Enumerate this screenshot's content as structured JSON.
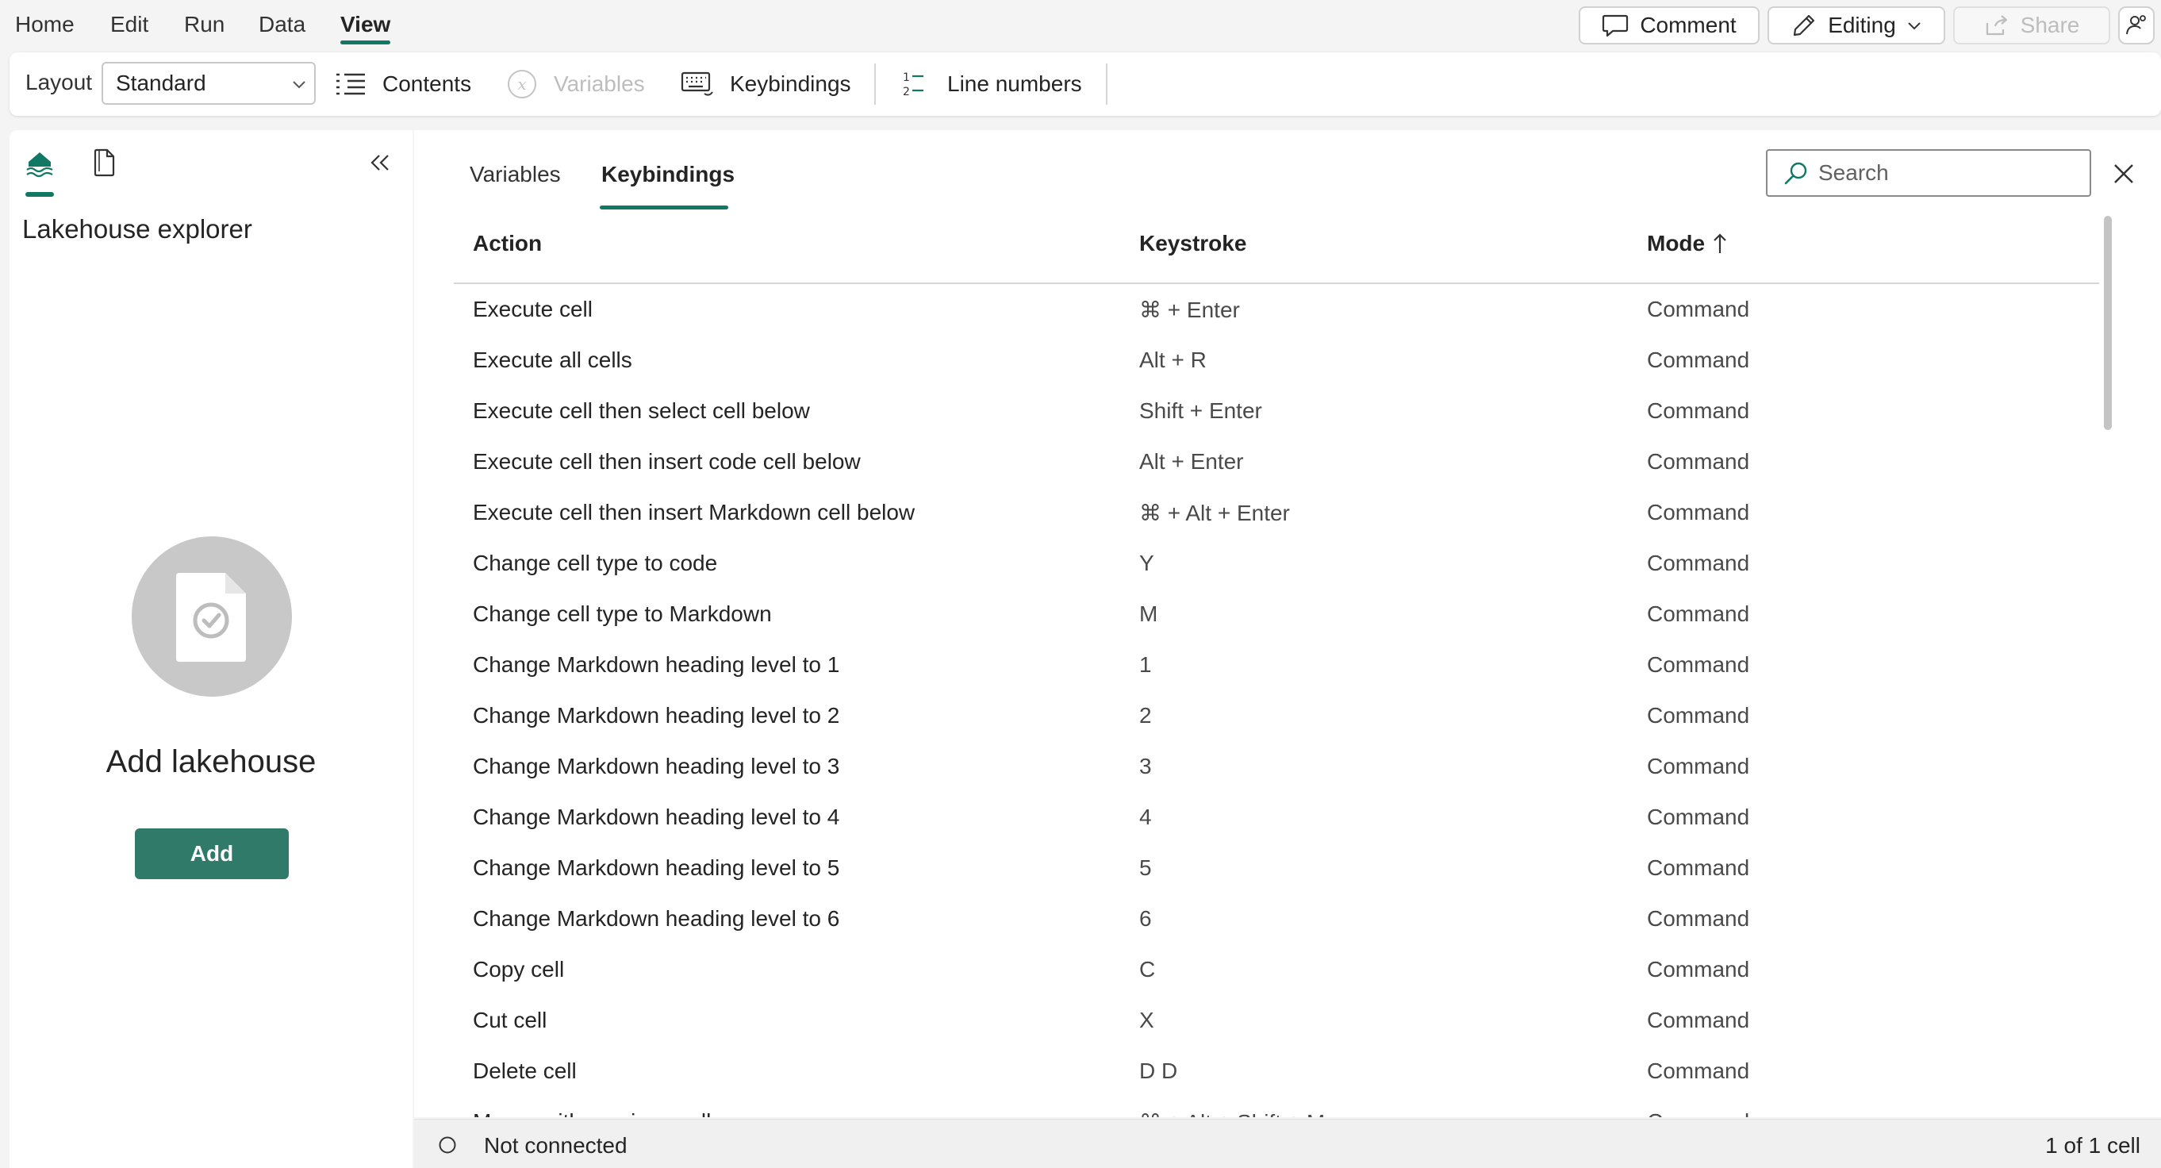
{
  "menu": {
    "items": [
      "Home",
      "Edit",
      "Run",
      "Data",
      "View"
    ],
    "active": "View"
  },
  "top_actions": {
    "comment_label": "Comment",
    "editing_label": "Editing",
    "share_label": "Share"
  },
  "toolbar": {
    "layout_label": "Layout",
    "layout_value": "Standard",
    "contents_label": "Contents",
    "variables_label": "Variables",
    "keybindings_label": "Keybindings",
    "line_numbers_label": "Line numbers"
  },
  "left_panel": {
    "title": "Lakehouse explorer",
    "empty_title": "Add lakehouse",
    "add_button": "Add"
  },
  "main": {
    "tabs": [
      "Variables",
      "Keybindings"
    ],
    "active_tab": "Keybindings",
    "search_placeholder": "Search",
    "table": {
      "columns": [
        "Action",
        "Keystroke",
        "Mode"
      ],
      "sort_column": "Mode",
      "sort_direction": "ascending",
      "rows": [
        {
          "action": "Execute cell",
          "keystroke": "⌘ + Enter",
          "mode": "Command"
        },
        {
          "action": "Execute all cells",
          "keystroke": "Alt + R",
          "mode": "Command"
        },
        {
          "action": "Execute cell then select cell below",
          "keystroke": "Shift + Enter",
          "mode": "Command"
        },
        {
          "action": "Execute cell then insert code cell below",
          "keystroke": "Alt + Enter",
          "mode": "Command"
        },
        {
          "action": "Execute cell then insert Markdown cell below",
          "keystroke": "⌘ + Alt + Enter",
          "mode": "Command"
        },
        {
          "action": "Change cell type to code",
          "keystroke": "Y",
          "mode": "Command"
        },
        {
          "action": "Change cell type to Markdown",
          "keystroke": "M",
          "mode": "Command"
        },
        {
          "action": "Change Markdown heading level to 1",
          "keystroke": "1",
          "mode": "Command"
        },
        {
          "action": "Change Markdown heading level to 2",
          "keystroke": "2",
          "mode": "Command"
        },
        {
          "action": "Change Markdown heading level to 3",
          "keystroke": "3",
          "mode": "Command"
        },
        {
          "action": "Change Markdown heading level to 4",
          "keystroke": "4",
          "mode": "Command"
        },
        {
          "action": "Change Markdown heading level to 5",
          "keystroke": "5",
          "mode": "Command"
        },
        {
          "action": "Change Markdown heading level to 6",
          "keystroke": "6",
          "mode": "Command"
        },
        {
          "action": "Copy cell",
          "keystroke": "C",
          "mode": "Command"
        },
        {
          "action": "Cut cell",
          "keystroke": "X",
          "mode": "Command"
        },
        {
          "action": "Delete cell",
          "keystroke": "D D",
          "mode": "Command"
        },
        {
          "action": "Merge with previous cell",
          "keystroke": "⌘ + Alt + Shift + M",
          "mode": "Command"
        }
      ]
    }
  },
  "status": {
    "connection": "Not connected",
    "cell_count": "1 of 1 cell"
  },
  "colors": {
    "accent": "#117865",
    "add_button": "#2f7a68",
    "placeholder_circle": "#c8c8c8"
  },
  "icons": {
    "lakehouse_tab": "lakehouse-icon",
    "resources_tab": "document-icon",
    "collapse": "double-chevron-left-icon",
    "close": "close-icon",
    "search": "search-icon",
    "sort": "arrow-up-icon"
  }
}
